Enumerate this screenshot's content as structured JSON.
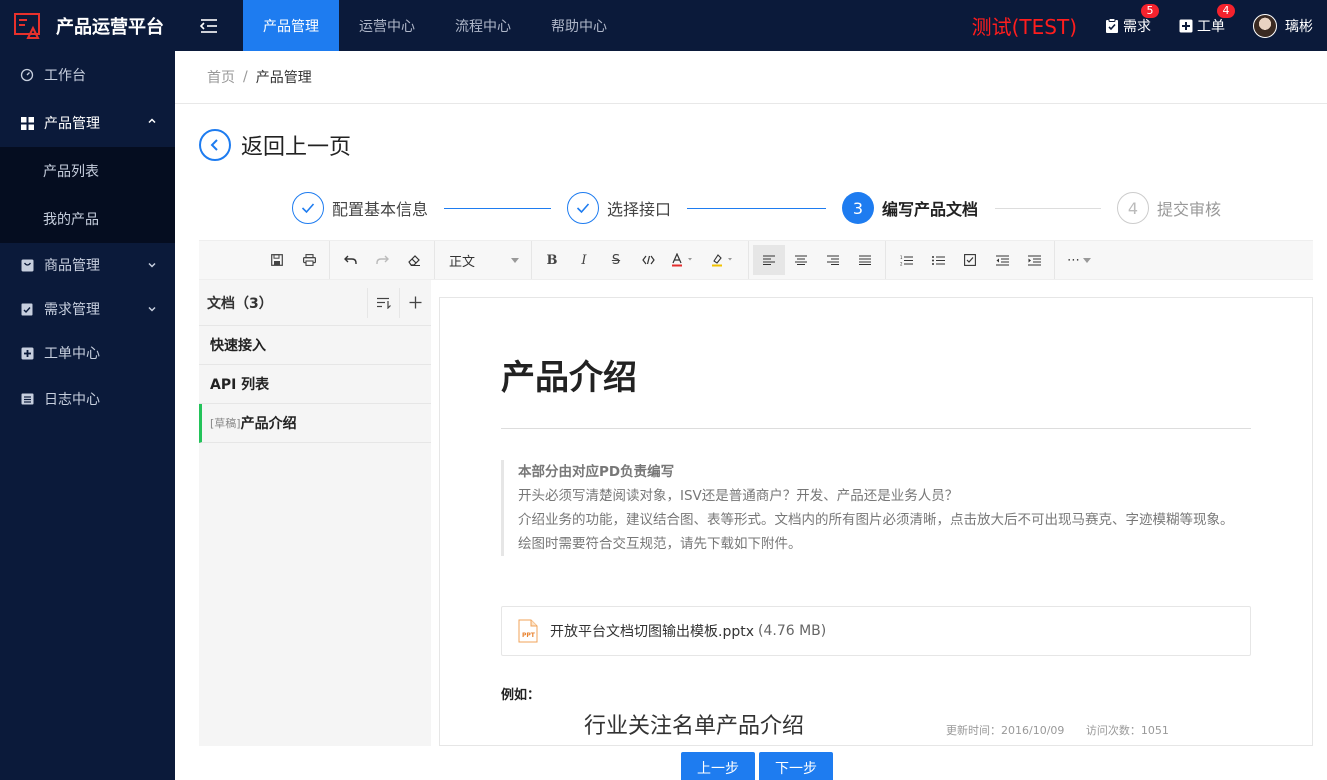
{
  "app": {
    "title": "产品运营平台"
  },
  "topnav": {
    "items": [
      {
        "label": "产品管理",
        "active": true
      },
      {
        "label": "运营中心",
        "active": false
      },
      {
        "label": "流程中心",
        "active": false
      },
      {
        "label": "帮助中心",
        "active": false
      }
    ],
    "env_label": "测试(TEST)",
    "requirements": {
      "label": "需求",
      "badge": "5"
    },
    "tickets": {
      "label": "工单",
      "badge": "4"
    },
    "user_name": "璃彬"
  },
  "sidebar": {
    "items": [
      {
        "label": "工作台",
        "icon": "dashboard-icon"
      },
      {
        "label": "产品管理",
        "icon": "grid-icon",
        "expanded": true
      },
      {
        "label": "产品列表"
      },
      {
        "label": "我的产品"
      },
      {
        "label": "商品管理",
        "icon": "shop-icon"
      },
      {
        "label": "需求管理",
        "icon": "clipboard-icon"
      },
      {
        "label": "工单中心",
        "icon": "ticket-icon"
      },
      {
        "label": "日志中心",
        "icon": "log-icon"
      }
    ]
  },
  "breadcrumb": {
    "home": "首页",
    "separator": "/",
    "current": "产品管理"
  },
  "back": {
    "label": "返回上一页"
  },
  "steps": [
    {
      "number": "1",
      "label": "配置基本信息",
      "status": "done"
    },
    {
      "number": "2",
      "label": "选择接口",
      "status": "done"
    },
    {
      "number": "3",
      "label": "编写产品文档",
      "status": "current"
    },
    {
      "number": "4",
      "label": "提交审核",
      "status": "todo"
    }
  ],
  "toolbar": {
    "paragraph_style": "正文",
    "more": "⋯"
  },
  "doclist": {
    "title": "文档（3）",
    "items": [
      {
        "label": "快速接入",
        "draft": ""
      },
      {
        "label": "API 列表",
        "draft": ""
      },
      {
        "label": "产品介绍",
        "draft": "[草稿]",
        "active": true
      }
    ]
  },
  "editor": {
    "title": "产品介绍",
    "quote": {
      "title": "本部分由对应PD负责编写",
      "lines": [
        "开头必须写清楚阅读对象，ISV还是普通商户？开发、产品还是业务人员？",
        "介绍业务的功能，建议结合图、表等形式。文档内的所有图片必须清晰，点击放大后不可出现马赛克、字迹模糊等现象。",
        "绘图时需要符合交互规范，请先下载如下附件。"
      ]
    },
    "attachment": {
      "name": "开放平台文档切图输出模板.pptx",
      "size": "(4.76 MB)",
      "icon_text": "PPT"
    },
    "example_label": "例如：",
    "sample_title": "行业关注名单产品介绍",
    "meta_updated": "更新时间：2016/10/09",
    "meta_visits": "访问次数：1051"
  },
  "footer": {
    "prev_label": "上一步",
    "next_label": "下一步"
  },
  "colors": {
    "primary": "#1e7cf0",
    "nav_bg": "#0b1a3a",
    "env_red": "#ff1d1d",
    "active_doc": "#23c35a"
  }
}
